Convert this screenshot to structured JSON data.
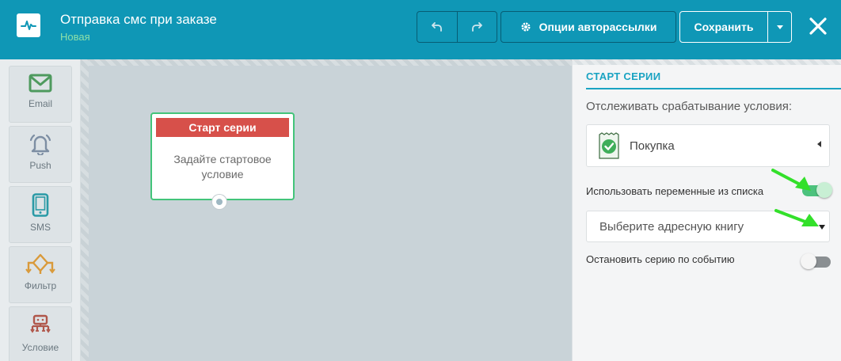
{
  "header": {
    "title": "Отправка смс при заказе",
    "subtitle": "Новая",
    "options_label": "Опции авторассылки",
    "save_label": "Сохранить"
  },
  "toolbar": {
    "items": [
      {
        "label": "Email",
        "icon": "envelope-icon",
        "color": "#4e9a5e"
      },
      {
        "label": "Push",
        "icon": "bell-icon",
        "color": "#7d8ea3"
      },
      {
        "label": "SMS",
        "icon": "phone-icon",
        "color": "#2a9aa6"
      },
      {
        "label": "Фильтр",
        "icon": "filter-tree-icon",
        "color": "#d99a3a"
      },
      {
        "label": "Условие",
        "icon": "condition-robot-icon",
        "color": "#b0574b"
      }
    ]
  },
  "canvas": {
    "node": {
      "header": "Старт серии",
      "body_line1": "Задайте стартовое",
      "body_line2": "условие"
    }
  },
  "panel": {
    "title": "СТАРТ СЕРИИ",
    "track_label": "Отслеживать срабатывание условия:",
    "trigger_value": "Покупка",
    "use_vars_label": "Использовать переменные из списка",
    "use_vars_on": true,
    "address_book_placeholder": "Выберите адресную книгу",
    "stop_label": "Остановить серию по событию",
    "stop_on": false
  },
  "colors": {
    "header_bg": "#0f97b6",
    "accent": "#1aa3c2",
    "node_head": "#d7504a",
    "node_border": "#43c47a",
    "toggle_on": "#4cc27d",
    "annotation_arrow": "#33e02a"
  }
}
